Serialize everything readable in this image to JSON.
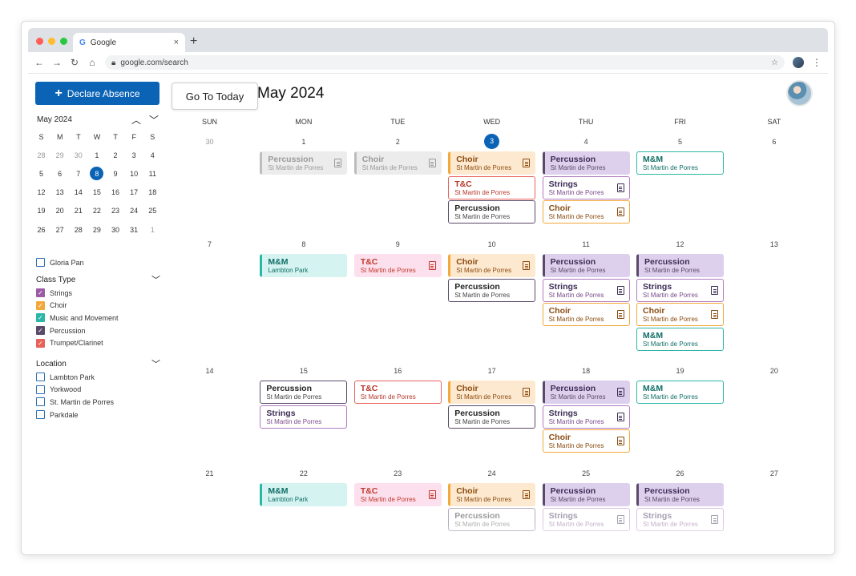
{
  "browser": {
    "tab_title": "Google",
    "tab_icon": "G",
    "new_tab": "+",
    "url": "google.com/search"
  },
  "sidebar": {
    "declare_button": "Declare Absence",
    "mini_month": "May 2024",
    "weekdays": [
      "S",
      "M",
      "T",
      "W",
      "T",
      "F",
      "S"
    ],
    "weeks": [
      [
        "28",
        "29",
        "30",
        "1",
        "2",
        "3",
        "4"
      ],
      [
        "5",
        "6",
        "7",
        "8",
        "9",
        "10",
        "11"
      ],
      [
        "12",
        "13",
        "14",
        "15",
        "16",
        "17",
        "18"
      ],
      [
        "19",
        "20",
        "21",
        "22",
        "23",
        "24",
        "25"
      ],
      [
        "26",
        "27",
        "28",
        "29",
        "30",
        "31",
        "1"
      ]
    ],
    "selected_day": "8",
    "person": "Gloria Pan",
    "class_type_heading": "Class Type",
    "class_types": [
      {
        "label": "Strings",
        "color": "#9b5ba5"
      },
      {
        "label": "Choir",
        "color": "#f2a83a"
      },
      {
        "label": "Music and Movement",
        "color": "#2bb6a8"
      },
      {
        "label": "Percussion",
        "color": "#5a4a6a"
      },
      {
        "label": "Trumpet/Clarinet",
        "color": "#e8625a"
      }
    ],
    "location_heading": "Location",
    "locations": [
      "Lambton Park",
      "Yorkwood",
      "St. Martin de Porres",
      "Parkdale"
    ]
  },
  "calendar": {
    "go_today": "Go To Today",
    "title": "May 2024",
    "weekday_headers": [
      "SUN",
      "MON",
      "TUE",
      "WED",
      "THU",
      "FRI",
      "SAT"
    ],
    "weeks": [
      [
        "30",
        "1",
        "2",
        "3",
        "4",
        "5",
        "6"
      ],
      [
        "7",
        "8",
        "9",
        "10",
        "11",
        "12",
        "13"
      ],
      [
        "14",
        "15",
        "16",
        "17",
        "18",
        "19",
        "20"
      ],
      [
        "21",
        "22",
        "23",
        "24",
        "25",
        "26",
        "27"
      ]
    ],
    "today": "3",
    "events": [
      {
        "week": 0,
        "day": 1,
        "slot": 0,
        "title": "Percussion",
        "loc": "St Martin de Porres",
        "style": "past",
        "doc": true
      },
      {
        "week": 0,
        "day": 2,
        "slot": 0,
        "title": "Choir",
        "loc": "St Martin de Porres",
        "style": "past",
        "doc": true
      },
      {
        "week": 0,
        "day": 3,
        "slot": 0,
        "title": "Choir",
        "loc": "St Martin de Porres",
        "style": "choir-fill",
        "doc": true
      },
      {
        "week": 0,
        "day": 3,
        "slot": 1,
        "title": "T&C",
        "loc": "St Martin de Porres",
        "style": "tc-outline",
        "doc": false
      },
      {
        "week": 0,
        "day": 3,
        "slot": 2,
        "title": "Percussion",
        "loc": "St Martin de Porres",
        "style": "perc-outline",
        "doc": false
      },
      {
        "week": 0,
        "day": 4,
        "slot": 0,
        "title": "Percussion",
        "loc": "St Martin de Porres",
        "style": "perc-fill",
        "doc": false
      },
      {
        "week": 0,
        "day": 4,
        "slot": 1,
        "title": "Strings",
        "loc": "St Martin de Porres",
        "style": "strings-outline",
        "doc": true
      },
      {
        "week": 0,
        "day": 4,
        "slot": 2,
        "title": "Choir",
        "loc": "St Martin de Porres",
        "style": "choir-outline",
        "doc": true
      },
      {
        "week": 0,
        "day": 5,
        "slot": 0,
        "title": "M&M",
        "loc": "St Martin de Porres",
        "style": "mm-outline",
        "doc": false
      },
      {
        "week": 1,
        "day": 1,
        "slot": 0,
        "title": "M&M",
        "loc": "Lambton Park",
        "style": "mm-fill",
        "doc": false
      },
      {
        "week": 1,
        "day": 2,
        "slot": 0,
        "title": "T&C",
        "loc": "St Martin de Porres",
        "style": "tc-fill",
        "doc": true
      },
      {
        "week": 1,
        "day": 3,
        "slot": 0,
        "title": "Choir",
        "loc": "St Martin de Porres",
        "style": "choir-fill",
        "doc": true
      },
      {
        "week": 1,
        "day": 3,
        "slot": 1,
        "title": "Percussion",
        "loc": "St Martin de Porres",
        "style": "perc-outline",
        "doc": false
      },
      {
        "week": 1,
        "day": 4,
        "slot": 0,
        "title": "Percussion",
        "loc": "St Martin de Porres",
        "style": "perc-fill",
        "doc": false
      },
      {
        "week": 1,
        "day": 4,
        "slot": 1,
        "title": "Strings",
        "loc": "St Martin de Porres",
        "style": "strings-outline",
        "doc": true
      },
      {
        "week": 1,
        "day": 4,
        "slot": 2,
        "title": "Choir",
        "loc": "St Martin de Porres",
        "style": "choir-outline",
        "doc": true
      },
      {
        "week": 1,
        "day": 5,
        "slot": 0,
        "title": "Percussion",
        "loc": "St Martin de Porres",
        "style": "perc-fill",
        "doc": false
      },
      {
        "week": 1,
        "day": 5,
        "slot": 1,
        "title": "Strings",
        "loc": "St Martin de Porres",
        "style": "strings-outline",
        "doc": true
      },
      {
        "week": 1,
        "day": 5,
        "slot": 2,
        "title": "Choir",
        "loc": "St Martin de Porres",
        "style": "choir-outline",
        "doc": true
      },
      {
        "week": 1,
        "day": 5,
        "slot": 3,
        "title": "M&M",
        "loc": "St Martin de Porres",
        "style": "mm-outline",
        "doc": false
      },
      {
        "week": 2,
        "day": 1,
        "slot": 0,
        "title": "Percussion",
        "loc": "St Martin de Porres",
        "style": "perc-outline",
        "doc": false
      },
      {
        "week": 2,
        "day": 1,
        "slot": 1,
        "title": "Strings",
        "loc": "St Martin de Porres",
        "style": "strings-outline",
        "doc": false
      },
      {
        "week": 2,
        "day": 2,
        "slot": 0,
        "title": "T&C",
        "loc": "St Martin de Porres",
        "style": "tc-outline",
        "doc": false
      },
      {
        "week": 2,
        "day": 3,
        "slot": 0,
        "title": "Choir",
        "loc": "St Martin de Porres",
        "style": "choir-fill",
        "doc": true
      },
      {
        "week": 2,
        "day": 3,
        "slot": 1,
        "title": "Percussion",
        "loc": "St Martin de Porres",
        "style": "perc-outline",
        "doc": false
      },
      {
        "week": 2,
        "day": 4,
        "slot": 0,
        "title": "Percussion",
        "loc": "St Martin de Porres",
        "style": "perc-fill",
        "doc": true
      },
      {
        "week": 2,
        "day": 4,
        "slot": 1,
        "title": "Strings",
        "loc": "St Martin de Porres",
        "style": "strings-outline",
        "doc": true
      },
      {
        "week": 2,
        "day": 4,
        "slot": 2,
        "title": "Choir",
        "loc": "St Martin de Porres",
        "style": "choir-outline",
        "doc": true
      },
      {
        "week": 2,
        "day": 5,
        "slot": 0,
        "title": "M&M",
        "loc": "St Martin de Porres",
        "style": "mm-outline",
        "doc": false
      },
      {
        "week": 3,
        "day": 1,
        "slot": 0,
        "title": "M&M",
        "loc": "Lambton Park",
        "style": "mm-fill",
        "doc": false
      },
      {
        "week": 3,
        "day": 2,
        "slot": 0,
        "title": "T&C",
        "loc": "St Martin de Porres",
        "style": "tc-fill",
        "doc": true
      },
      {
        "week": 3,
        "day": 3,
        "slot": 0,
        "title": "Choir",
        "loc": "St Martin de Porres",
        "style": "choir-fill",
        "doc": true
      },
      {
        "week": 3,
        "day": 3,
        "slot": 1,
        "title": "Percussion",
        "loc": "St Martin de Porres",
        "style": "perc-outline",
        "doc": false
      },
      {
        "week": 3,
        "day": 4,
        "slot": 0,
        "title": "Percussion",
        "loc": "St Martin de Porres",
        "style": "perc-fill",
        "doc": false
      },
      {
        "week": 3,
        "day": 4,
        "slot": 1,
        "title": "Strings",
        "loc": "St Martin de Porres",
        "style": "strings-outline",
        "doc": true
      },
      {
        "week": 3,
        "day": 5,
        "slot": 0,
        "title": "Percussion",
        "loc": "St Martin de Porres",
        "style": "perc-fill",
        "doc": false
      },
      {
        "week": 3,
        "day": 5,
        "slot": 1,
        "title": "Strings",
        "loc": "St Martin de Porres",
        "style": "strings-outline",
        "doc": true
      }
    ]
  },
  "styles": {
    "past": {
      "bg": "#ececec",
      "border": "#ececec",
      "bar": "#bdbdbd",
      "title": "#9a9a9a",
      "sub": "#9a9a9a"
    },
    "choir-fill": {
      "bg": "#fde9cf",
      "border": "#fde9cf",
      "bar": "#f2a83a",
      "title": "#8a4b10",
      "sub": "#8a4b10"
    },
    "choir-outline": {
      "bg": "#ffffff",
      "border": "#f2a83a",
      "bar": "",
      "title": "#8a4b10",
      "sub": "#8a4b10"
    },
    "tc-fill": {
      "bg": "#fde0ee",
      "border": "#fde0ee",
      "bar": "",
      "title": "#c0392b",
      "sub": "#c0392b"
    },
    "tc-outline": {
      "bg": "#ffffff",
      "border": "#e8625a",
      "bar": "",
      "title": "#b5362a",
      "sub": "#b5362a"
    },
    "perc-fill": {
      "bg": "#ddd0ec",
      "border": "#ddd0ec",
      "bar": "#5a4a6a",
      "title": "#3d2d55",
      "sub": "#5a4a6a"
    },
    "perc-outline": {
      "bg": "#ffffff",
      "border": "#5a4a6a",
      "bar": "",
      "title": "#222222",
      "sub": "#444444"
    },
    "strings-outline": {
      "bg": "#ffffff",
      "border": "#b07cc0",
      "bar": "",
      "title": "#3d2d55",
      "sub": "#7a4a8a"
    },
    "mm-fill": {
      "bg": "#d5f3f0",
      "border": "#d5f3f0",
      "bar": "#2bb6a8",
      "title": "#0f6e66",
      "sub": "#0f6e66"
    },
    "mm-outline": {
      "bg": "#ffffff",
      "border": "#2bb6a8",
      "bar": "",
      "title": "#0f6e66",
      "sub": "#0f6e66"
    }
  }
}
